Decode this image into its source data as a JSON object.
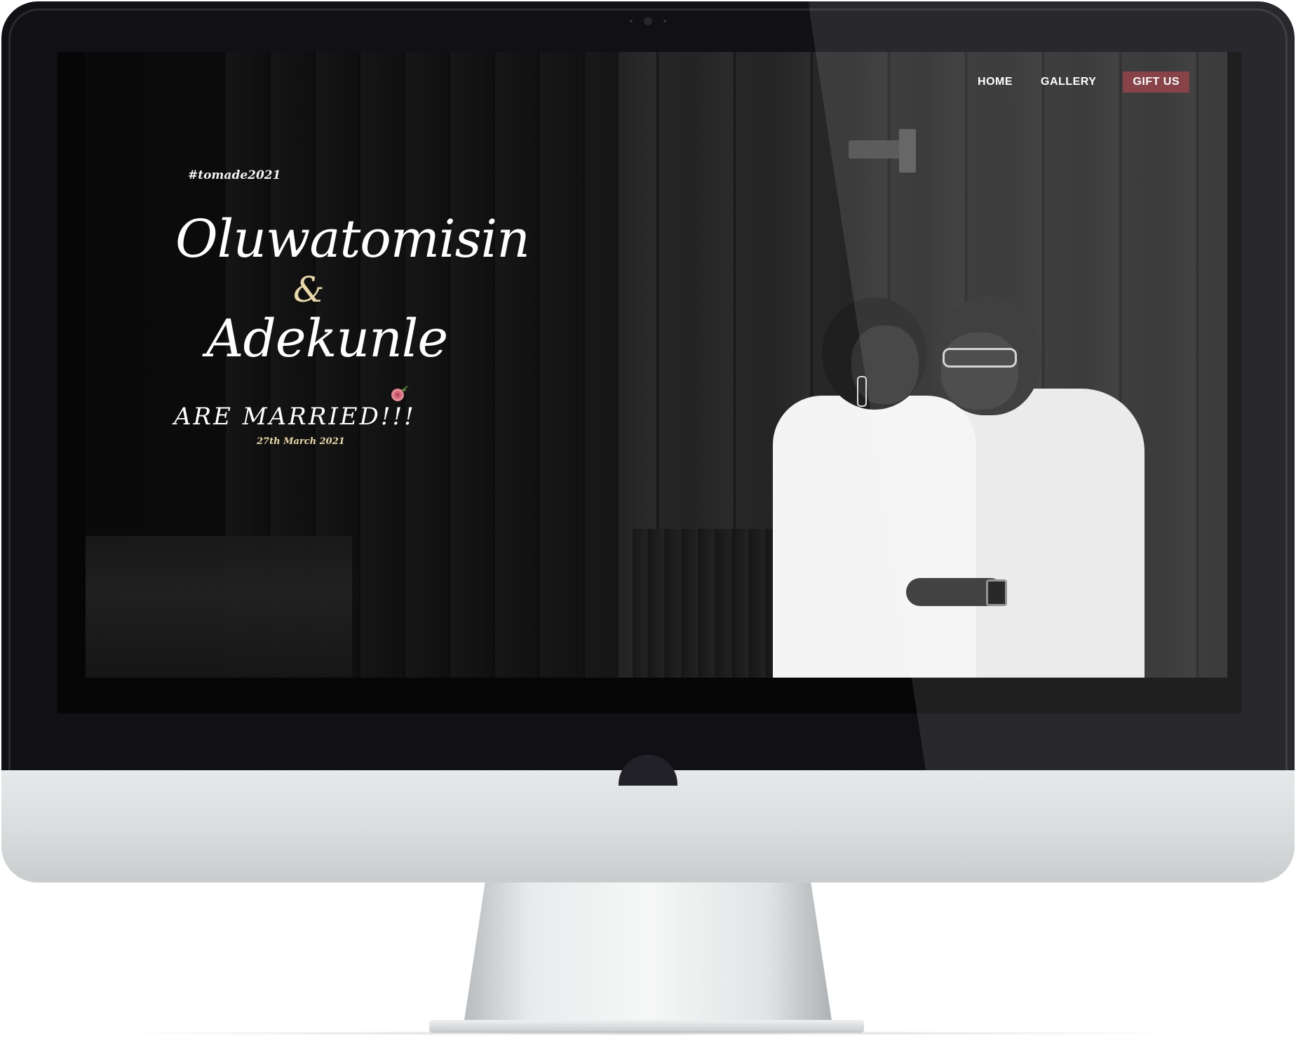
{
  "nav": {
    "home": "HOME",
    "gallery": "GALLERY",
    "gift": "GIFT US"
  },
  "hero": {
    "hashtag": "#tomade2021",
    "name_one": "Oluwatomisin",
    "ampersand": "&",
    "name_two": "Adekunle",
    "headline": "ARE MARRIED!!!",
    "date": "27th March 2021"
  },
  "colors": {
    "gift_button": "#7a2e34",
    "accent_gold": "#e8d8a8",
    "background": "#0a0a0a"
  },
  "icons": [
    "rose-icon"
  ]
}
